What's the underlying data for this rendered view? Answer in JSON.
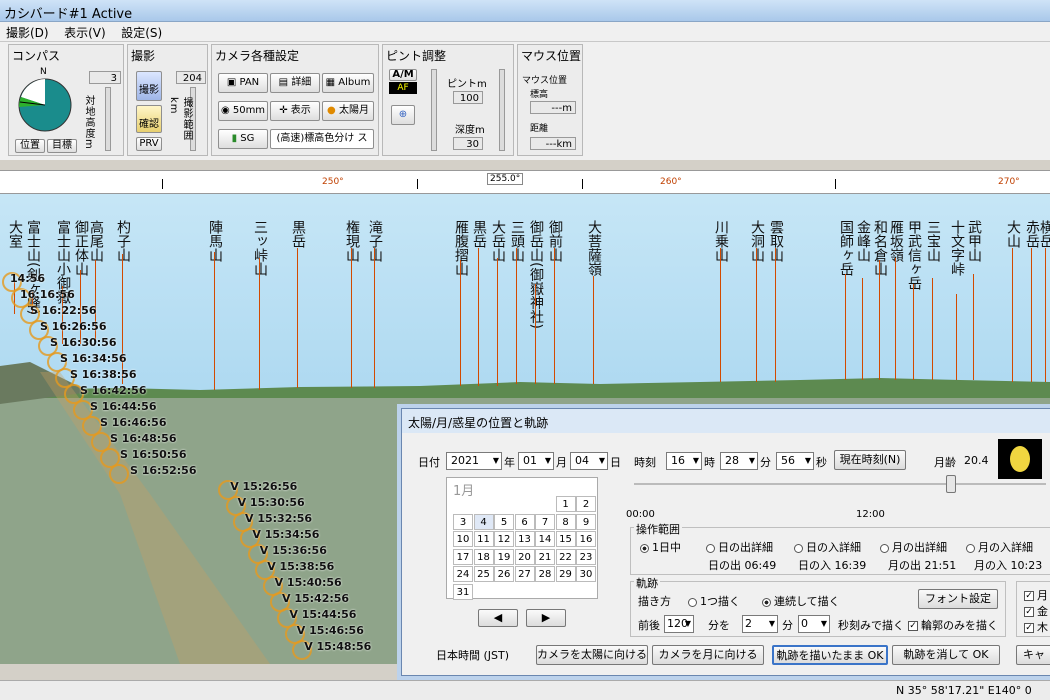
{
  "window": {
    "title": "カシバード#1 Active"
  },
  "menu": [
    "撮影(D)",
    "表示(V)",
    "設定(S)"
  ],
  "toolbar": {
    "compass": {
      "title": "コンパス",
      "north": "N",
      "btn_position": "位置",
      "btn_target": "目標",
      "value": "3",
      "label_vertical": "対地高度m"
    },
    "shoot": {
      "title": "撮影",
      "btn_shoot": "撮影",
      "btn_confirm": "確認",
      "btn_prv": "PRV",
      "value": "204",
      "label_vertical": "撮影範囲km"
    },
    "camera": {
      "title": "カメラ各種設定",
      "btn_pan": "PAN",
      "btn_detail": "詳細",
      "btn_album": "Album",
      "btn_lens": "50mm",
      "btn_display": "表示",
      "btn_sunmoon": "太陽月",
      "btn_sg": "SG",
      "mode": "(高速)標高色分け ス"
    },
    "focus": {
      "title": "ピント調整",
      "am": "A/M",
      "af": "AF",
      "focus_label": "ピントm",
      "focus_value": "100",
      "depth_label": "深度m",
      "depth_value": "30"
    },
    "mouse": {
      "title": "マウス位置",
      "sub": "マウス位置",
      "elev_label": "標高",
      "elev_value": "---m",
      "dist_label": "距離",
      "dist_value": "---km"
    }
  },
  "ruler": {
    "current": "255.0°",
    "labels": [
      "250°",
      "260°",
      "270°"
    ]
  },
  "peaks": [
    {
      "name": "大室"
    },
    {
      "name": "富士山(剣ヶ峰)"
    },
    {
      "name": "富士山小御嶽"
    },
    {
      "name": "御正体山"
    },
    {
      "name": "高尾山"
    },
    {
      "name": "杓子山"
    },
    {
      "name": "陣馬山"
    },
    {
      "name": "三ッ峠山"
    },
    {
      "name": "黒岳"
    },
    {
      "name": "権現山"
    },
    {
      "name": "滝子山"
    },
    {
      "name": "雁腹摺山"
    },
    {
      "name": "黒岳"
    },
    {
      "name": "大岳山"
    },
    {
      "name": "三頭山"
    },
    {
      "name": "御岳山(御嶽神社)"
    },
    {
      "name": "御前山"
    },
    {
      "name": "大菩薩嶺"
    },
    {
      "name": "川乗山"
    },
    {
      "name": "大洞山"
    },
    {
      "name": "雲取山"
    },
    {
      "name": "国師ヶ岳"
    },
    {
      "name": "金峰山"
    },
    {
      "name": "和名倉山"
    },
    {
      "name": "雁坂嶺"
    },
    {
      "name": "甲武信ヶ岳"
    },
    {
      "name": "三宝山"
    },
    {
      "name": "十文字峠"
    },
    {
      "name": "武甲山"
    },
    {
      "name": "大山"
    },
    {
      "name": "赤岳"
    },
    {
      "name": "横岳"
    }
  ],
  "sun_track": [
    "14:56",
    "16:16:56",
    "S 16:22:56",
    "S 16:26:56",
    "S 16:30:56",
    "S 16:34:56",
    "S 16:38:56",
    "S 16:42:56",
    "S 16:44:56",
    "S 16:46:56",
    "S 16:48:56",
    "S 16:50:56",
    "S 16:52:56",
    "V 15:26:56",
    "V 15:30:56",
    "V 15:32:56",
    "V 15:34:56",
    "V 15:36:56",
    "V 15:38:56",
    "V 15:40:56",
    "V 15:42:56",
    "V 15:44:56",
    "V 15:46:56",
    "V 15:48:56"
  ],
  "dialog": {
    "title": "太陽/月/惑星の位置と軌跡",
    "date_label": "日付",
    "year": "2021",
    "year_unit": "年",
    "month": "01",
    "month_unit": "月",
    "day": "04",
    "day_unit": "日",
    "time_label": "時刻",
    "hour": "16",
    "hour_unit": "時",
    "minute": "28",
    "minute_unit": "分",
    "second": "56",
    "second_unit": "秒",
    "now_btn": "現在時刻(N)",
    "moon_age_label": "月齢",
    "moon_age": "20.4",
    "calendar": {
      "month_label": "1月",
      "days": [
        "1",
        "2",
        "3",
        "4",
        "5",
        "6",
        "7",
        "8",
        "9",
        "10",
        "11",
        "12",
        "13",
        "14",
        "15",
        "16",
        "17",
        "18",
        "19",
        "20",
        "21",
        "22",
        "23",
        "24",
        "25",
        "26",
        "27",
        "28",
        "29",
        "30",
        "31"
      ],
      "selected": "4"
    },
    "timeline_start": "00:00",
    "timeline_mid": "12:00",
    "op_range_label": "操作範囲",
    "op_range": [
      "1日中",
      "日の出詳細",
      "日の入詳細",
      "月の出詳細",
      "月の入詳細"
    ],
    "sunrise_label": "日の出",
    "sunrise": "06:49",
    "sunset_label": "日の入",
    "sunset": "16:39",
    "moonrise_label": "月の出",
    "moonrise": "21:51",
    "moonset_label": "月の入",
    "moonset": "10:23",
    "track_label": "軌跡",
    "draw_mode_label": "描き方",
    "draw_once": "1つ描く",
    "draw_cont": "連続して描く",
    "font_btn": "フォント設定",
    "before_after_label": "前後",
    "before_after_value": "120",
    "min_unit": "分を",
    "interval_min": "2",
    "interval_min_unit": "分",
    "interval_sec": "0",
    "interval_sec_unit": "秒刻みで描く",
    "outline_only": "輪郭のみを描く",
    "tz": "日本時間 (JST)",
    "btn_cam_sun": "カメラを太陽に向ける",
    "btn_cam_moon": "カメラを月に向ける",
    "btn_ok_keep": "軌跡を描いたまま OK",
    "btn_ok_clear": "軌跡を消して OK",
    "btn_cancel": "キャ",
    "right_checks": [
      "月",
      "金",
      "木"
    ]
  },
  "status": {
    "coords": "N 35° 58'17.21\"  E140° 0"
  }
}
